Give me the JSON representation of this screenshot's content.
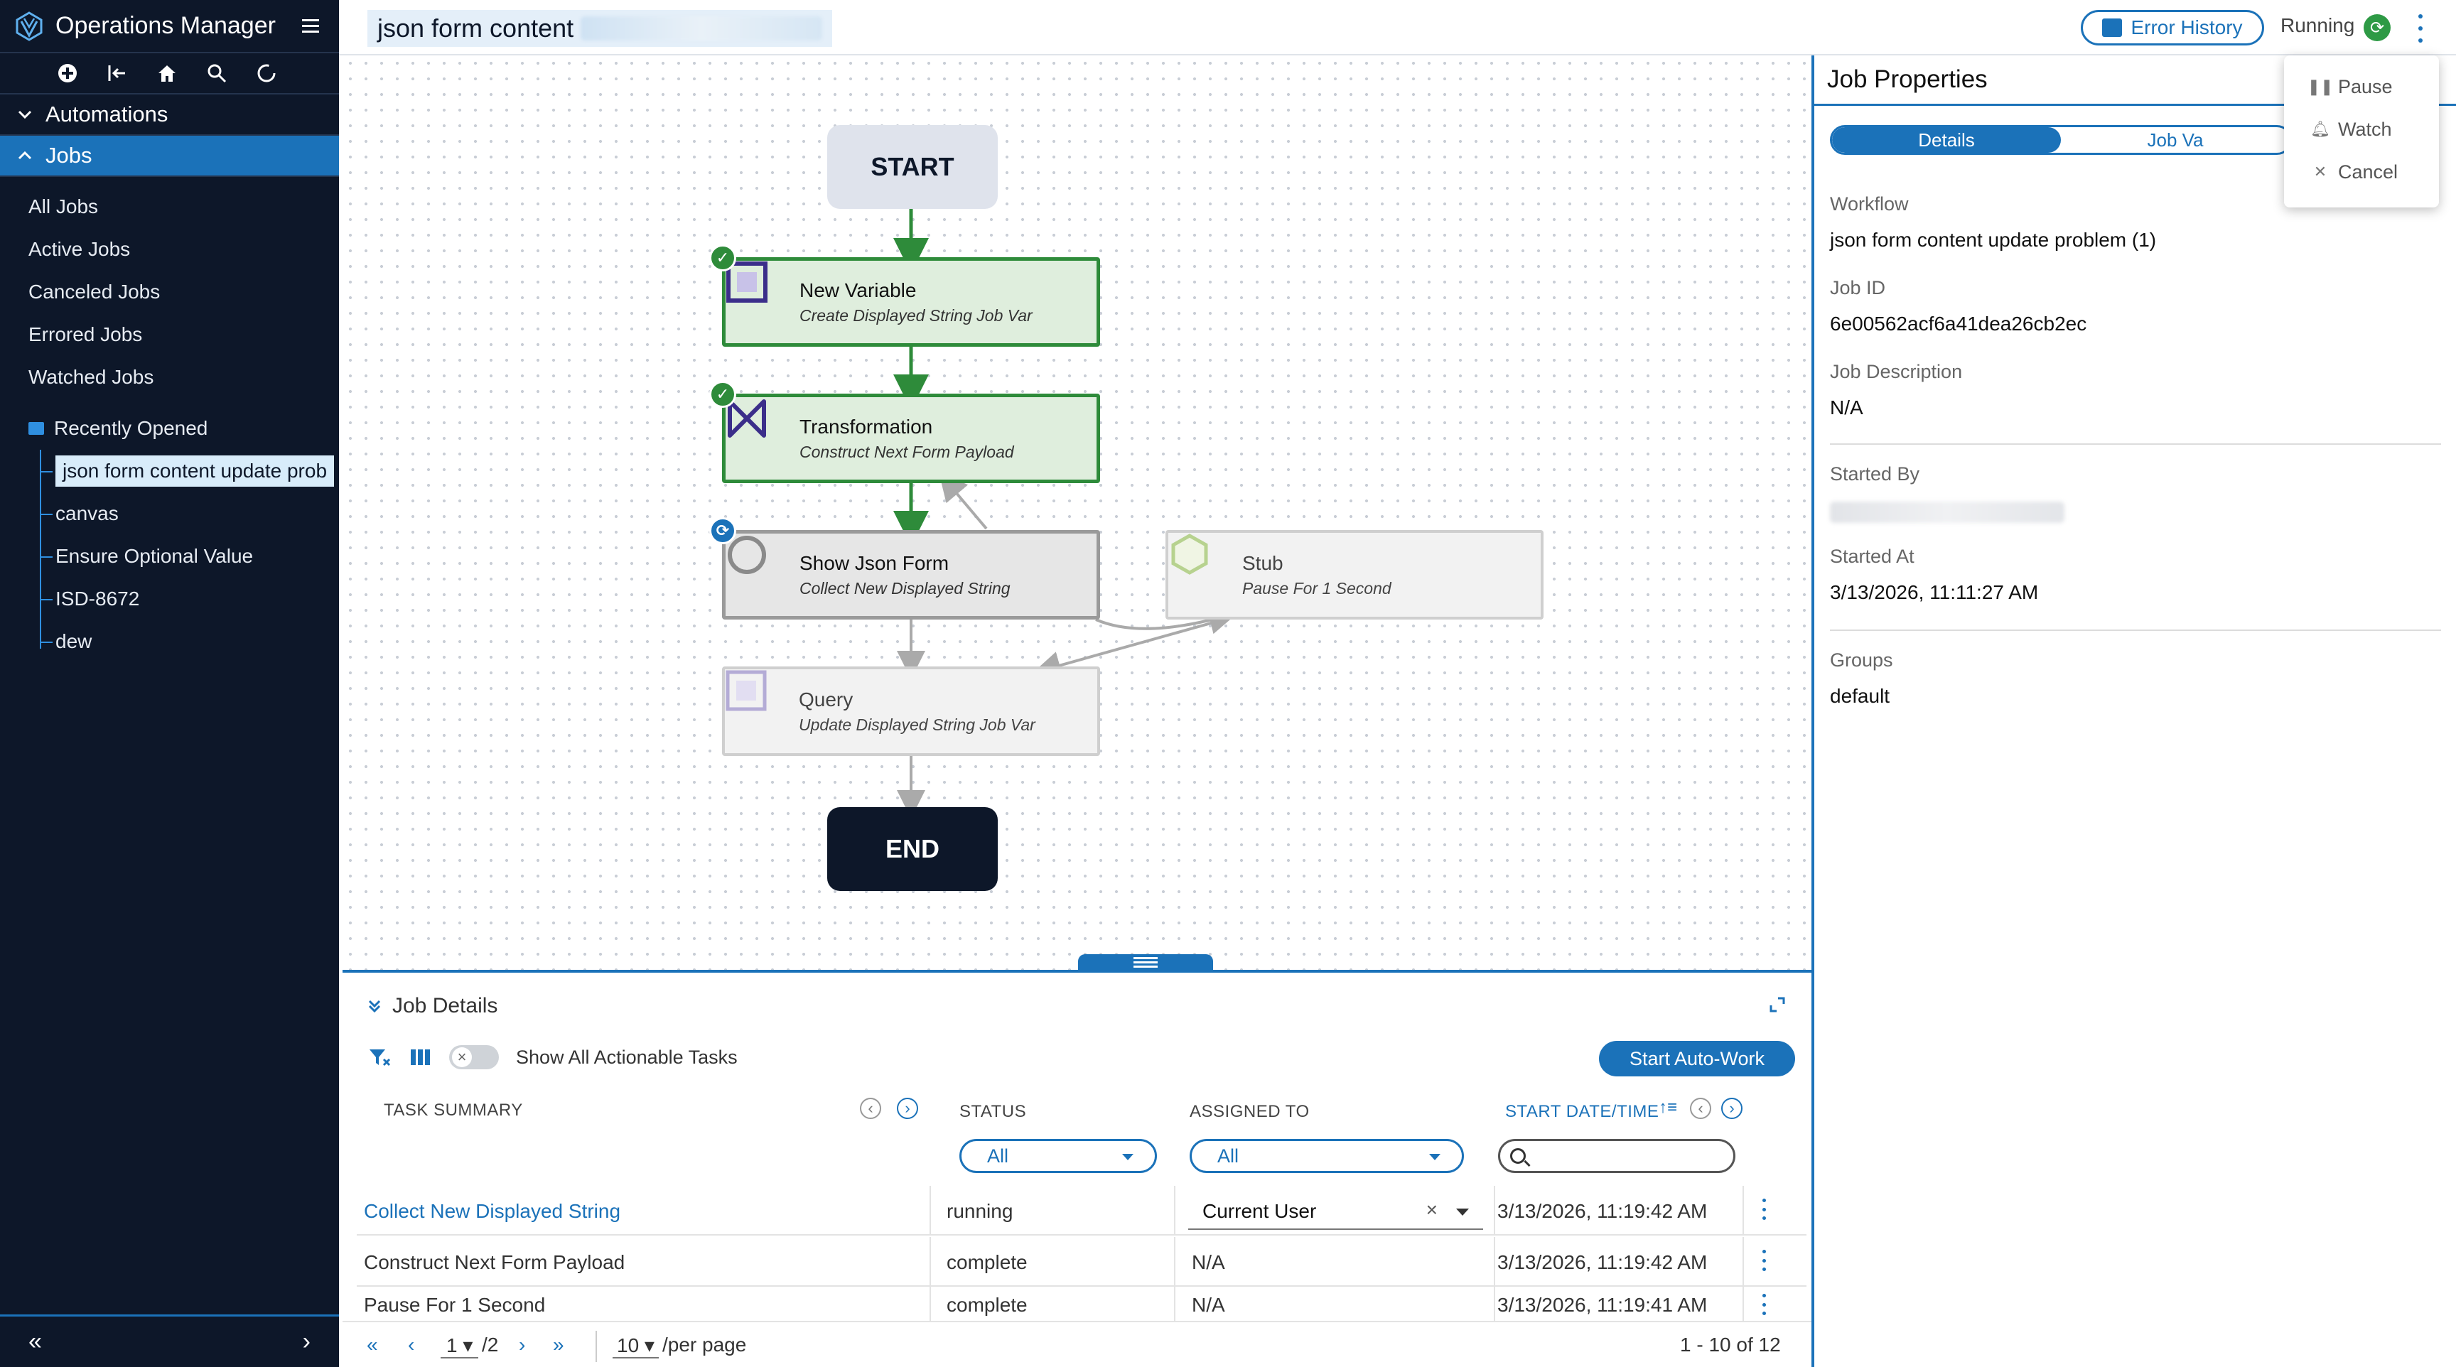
{
  "app": {
    "title": "Operations Manager"
  },
  "sidebar": {
    "sections": {
      "automations": "Automations",
      "jobs": "Jobs"
    },
    "jobs_items": [
      "All Jobs",
      "Active Jobs",
      "Canceled Jobs",
      "Errored Jobs",
      "Watched Jobs"
    ],
    "recently_opened": {
      "label": "Recently Opened",
      "items": [
        "json form content update prob",
        "canvas",
        "Ensure Optional Value",
        "ISD-8672",
        "dew"
      ]
    },
    "footer": {
      "collapse": "«",
      "expand": "›"
    }
  },
  "topbar": {
    "workflow_title": "json form content",
    "error_history": "Error History",
    "status": "Running"
  },
  "menu": {
    "items": [
      "Pause",
      "Watch",
      "Cancel"
    ]
  },
  "canvas": {
    "start": "START",
    "end": "END",
    "nodes": [
      {
        "title": "New Variable",
        "subtitle": "Create Displayed String Job Var"
      },
      {
        "title": "Transformation",
        "subtitle": "Construct Next Form Payload"
      },
      {
        "title": "Show Json Form",
        "subtitle": "Collect New Displayed String"
      },
      {
        "title": "Stub",
        "subtitle": "Pause For 1 Second"
      },
      {
        "title": "Query",
        "subtitle": "Update Displayed String Job Var"
      }
    ]
  },
  "job_properties": {
    "title": "Job Properties",
    "tabs": [
      "Details",
      "Job Va"
    ],
    "fields": {
      "workflow_label": "Workflow",
      "workflow_value": "json form content update problem (1)",
      "job_id_label": "Job ID",
      "job_id_value": "6e00562acf6a41dea26cb2ec",
      "description_label": "Job Description",
      "description_value": "N/A",
      "started_by_label": "Started By",
      "started_at_label": "Started At",
      "started_at_value": "3/13/2026, 11:11:27 AM",
      "groups_label": "Groups",
      "groups_value": "default"
    }
  },
  "job_details": {
    "title": "Job Details",
    "toggle_label": "Show All Actionable Tasks",
    "auto_work": "Start Auto-Work",
    "columns": {
      "task_summary": "TASK SUMMARY",
      "status": "STATUS",
      "assigned_to": "ASSIGNED TO",
      "start_date": "START DATE/TIME"
    },
    "filters": {
      "status": "All",
      "assigned": "All"
    },
    "rows": [
      {
        "task": "Collect New Displayed String",
        "status": "running",
        "assigned": "Current User",
        "date": "3/13/2026, 11:19:42 AM"
      },
      {
        "task": "Construct Next Form Payload",
        "status": "complete",
        "assigned": "N/A",
        "date": "3/13/2026, 11:19:42 AM"
      },
      {
        "task": "Pause For 1 Second",
        "status": "complete",
        "assigned": "N/A",
        "date": "3/13/2026, 11:19:41 AM"
      }
    ],
    "pager": {
      "page": "1",
      "of": "/2",
      "per_page": "10",
      "per_page_label": "/per page",
      "range": "1 - 10 of 12"
    }
  }
}
